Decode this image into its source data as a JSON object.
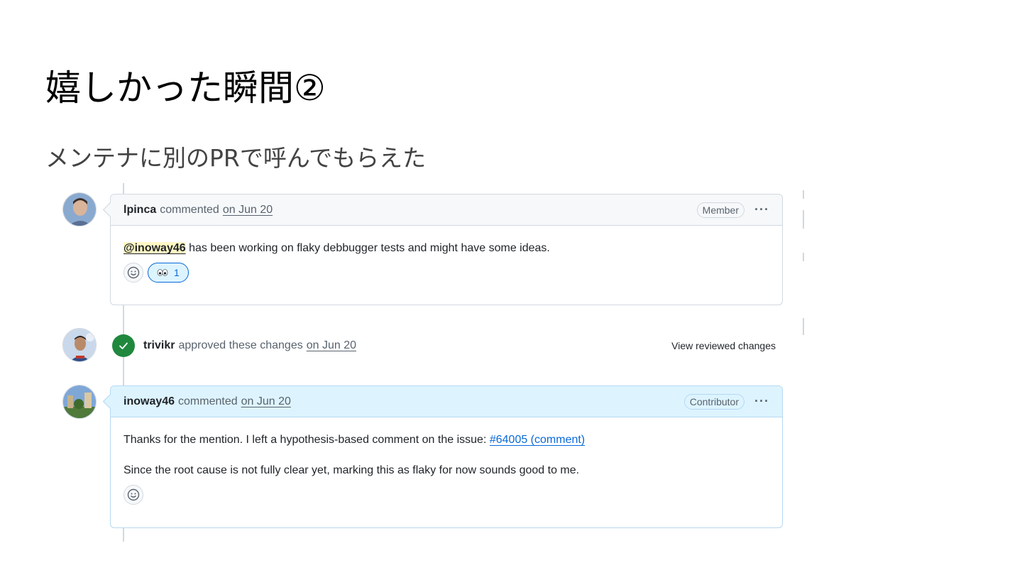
{
  "slide": {
    "title": "嬉しかった瞬間②",
    "subtitle": "メンテナに別のPRで呼んでもらえた"
  },
  "comments": [
    {
      "author": "lpinca",
      "action": "commented",
      "date": "on Jun 20",
      "role": "Member",
      "mention": "@inoway46",
      "text": "has been working on flaky debbugger tests and might have some ideas.",
      "reactions": [
        {
          "emoji": "eyes-icon",
          "count": "1"
        }
      ]
    },
    {
      "author": "inoway46",
      "action": "commented",
      "date": "on Jun 20",
      "role": "Contributor",
      "line1": "Thanks for the mention. I left a hypothesis-based comment on the issue:",
      "link": "#64005 (comment)",
      "line2": "Since the root cause is not fully clear yet, marking this as flaky for now sounds good to me."
    }
  ],
  "review": {
    "author": "trivikr",
    "action": "approved these changes",
    "date": "on Jun 20",
    "view_label": "View reviewed changes"
  },
  "more_label": "···",
  "colors": {
    "approve_green": "#1f883d",
    "link_blue": "#0969da",
    "mention_bg": "#fff8c5",
    "contributor_header_bg": "#ddf4ff"
  }
}
